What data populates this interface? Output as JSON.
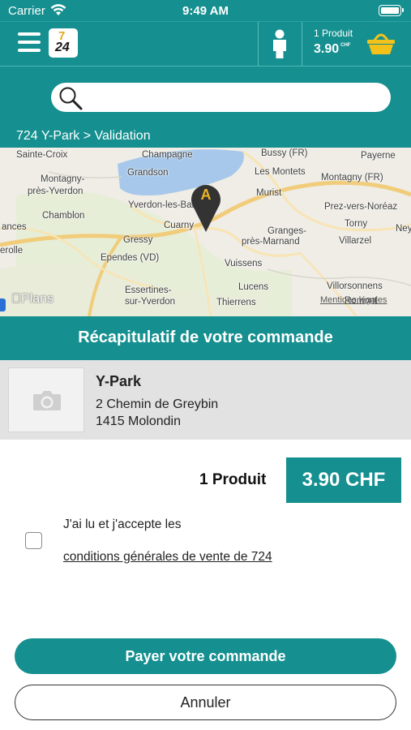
{
  "status_bar": {
    "carrier": "Carrier",
    "time": "9:49 AM"
  },
  "header": {
    "logo_top": "7",
    "logo_bottom": "24",
    "cart_count": "1 Produit",
    "cart_price": "3.90",
    "cart_currency": "CHF"
  },
  "search": {
    "placeholder": ""
  },
  "breadcrumb": "724 Y-Park > Validation",
  "map": {
    "marker_letter": "A",
    "attribution": "Plans",
    "legal": "Mentions légales",
    "places": [
      "Sainte-Croix",
      "Champagne",
      "Bussy (FR)",
      "Payerne",
      "Grandson",
      "Les Montets",
      "Montagny (FR)",
      "Montagny-",
      "près-Yverdon",
      "Murist",
      "Prez-vers-Noréaz",
      "Yverdon-les-Bains",
      "Chamblon",
      "Cuarny",
      "Granges-",
      "près-Marnand",
      "Torny",
      "Ney",
      "Gressy",
      "Villarzel",
      "erolle",
      "Ependes (VD)",
      "Vuissens",
      "Lucens",
      "Villorsonnens",
      "Essertines-",
      "sur-Yverdon",
      "Thierrens",
      "Romont",
      "ances"
    ]
  },
  "recap": {
    "title": "Récapitulatif de votre commande",
    "store_name": "Y-Park",
    "street": "2 Chemin de Greybin",
    "city": "1415 Molondin"
  },
  "totals": {
    "count_label": "1 Produit",
    "price_label": "3.90 CHF"
  },
  "terms": {
    "text": "J'ai lu et j'accepte les",
    "link": "conditions générales de vente de 724",
    "accepted": false
  },
  "actions": {
    "pay": "Payer votre commande",
    "cancel": "Annuler"
  },
  "colors": {
    "brand": "#158f8f",
    "accent": "#e8b42a",
    "card_bg": "#e2e2e2"
  }
}
